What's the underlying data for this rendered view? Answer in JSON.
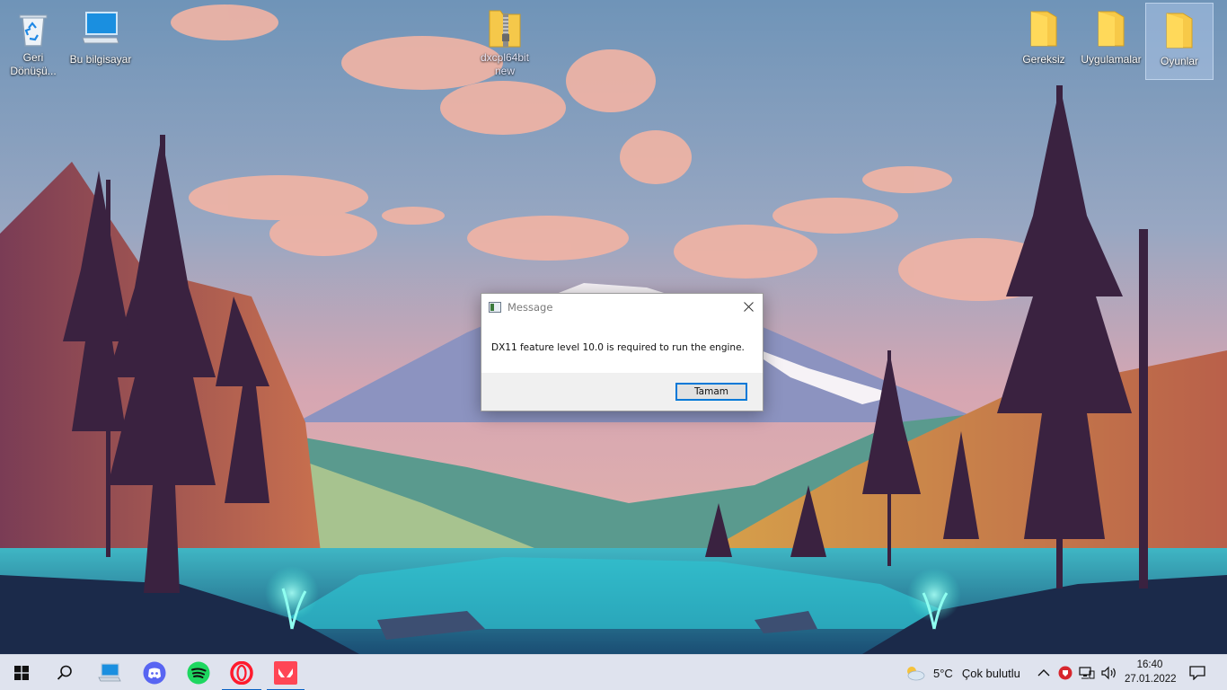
{
  "desktop": {
    "icons_left": [
      {
        "label": "Geri Dönüşü...",
        "icon": "recycle-bin-icon"
      },
      {
        "label": "Bu bilgisayar",
        "icon": "computer-icon"
      }
    ],
    "icon_center": {
      "label": "dxcpl64bit new",
      "icon": "zip-folder-icon"
    },
    "icons_right": [
      {
        "label": "Gereksiz",
        "icon": "folder-icon"
      },
      {
        "label": "Uygulamalar",
        "icon": "folder-icon"
      },
      {
        "label": "Oyunlar",
        "icon": "folder-icon",
        "selected": true
      }
    ]
  },
  "dialog": {
    "title": "Message",
    "message": "DX11 feature level 10.0 is required to run the engine.",
    "ok_label": "Tamam"
  },
  "taskbar": {
    "apps": [
      {
        "name": "start",
        "icon": "windows-logo-icon"
      },
      {
        "name": "search",
        "icon": "search-icon"
      },
      {
        "name": "this-pc",
        "icon": "computer-icon"
      },
      {
        "name": "discord",
        "icon": "discord-icon",
        "color": "#5865f2"
      },
      {
        "name": "spotify",
        "icon": "spotify-icon",
        "color": "#1ed760"
      },
      {
        "name": "opera",
        "icon": "opera-icon",
        "color": "#ff1b2d",
        "active": true
      },
      {
        "name": "valorant",
        "icon": "valorant-icon",
        "color": "#ff4655",
        "active": true
      }
    ],
    "weather": {
      "temp": "5°C",
      "condition": "Çok bulutlu",
      "icon": "partly-cloudy-icon"
    },
    "clock": {
      "time": "16:40",
      "date": "27.01.2022"
    }
  }
}
